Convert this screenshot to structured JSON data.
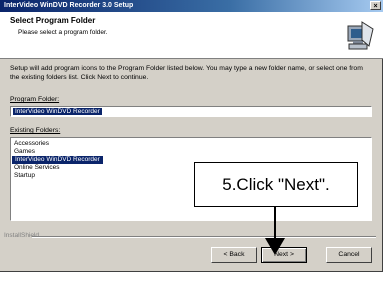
{
  "window": {
    "title": "InterVideo WinDVD Recorder 3.0 Setup",
    "close_glyph": "×"
  },
  "header": {
    "title": "Select Program Folder",
    "subtitle": "Please select a program folder."
  },
  "description": "Setup will add program icons to the Program Folder listed below. You may type a new folder name, or select one from the existing folders list. Click Next to continue.",
  "program_folder": {
    "label": "Program Folder:",
    "value": "InterVideo WinDVD Recorder"
  },
  "existing_folders": {
    "label": "Existing Folders:",
    "items": [
      "Accessories",
      "Games",
      "InterVideo WinDVD Recorder",
      "Online Services",
      "Startup"
    ],
    "selected_index": 2
  },
  "callout": {
    "text": "5.Click \"Next\"."
  },
  "footer": {
    "brand": "InstallShield"
  },
  "buttons": {
    "back": "< Back",
    "next": "Next >",
    "cancel": "Cancel"
  }
}
